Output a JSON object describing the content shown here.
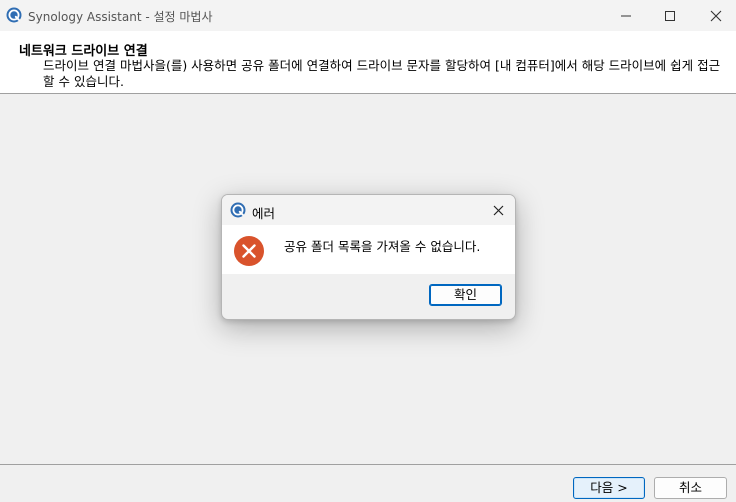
{
  "window": {
    "title": "Synology Assistant - 설정 마법사",
    "controls": {
      "minimize_icon": "minimize-icon",
      "maximize_icon": "maximize-icon",
      "close_icon": "close-icon"
    }
  },
  "header": {
    "title": "네트워크 드라이브 연결",
    "description": "드라이브 연결 마법사을(를) 사용하면 공유 폴더에 연결하여 드라이브 문자를 할당하여 [내 컴퓨터]에서 해당 드라이브에 쉽게 접근할 수 있습니다."
  },
  "footer": {
    "next_label": "다음 >",
    "cancel_label": "취소"
  },
  "dialog": {
    "title": "에러",
    "message": "공유 폴더 목록을 가져올 수 없습니다.",
    "ok_label": "확인",
    "icon": "error-icon"
  },
  "colors": {
    "accent": "#0067c0",
    "error": "#c42b1c",
    "app_icon": "#2f6db3"
  }
}
